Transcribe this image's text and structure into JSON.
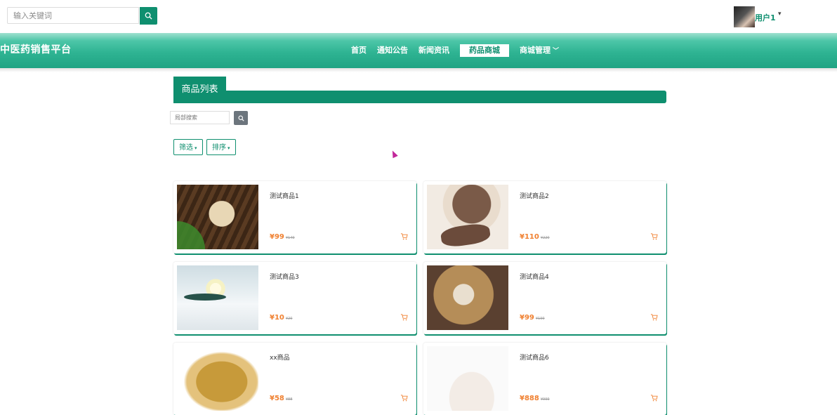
{
  "topbar": {
    "search_placeholder": "输入关键词",
    "username": "用户1"
  },
  "header": {
    "brand": "中医药销售平台",
    "nav": [
      {
        "label": "首页"
      },
      {
        "label": "通知公告"
      },
      {
        "label": "新闻资讯"
      },
      {
        "label": "药品商城",
        "active": true
      },
      {
        "label": "商城管理"
      }
    ]
  },
  "section": {
    "title": "商品列表",
    "local_search_placeholder": "局部搜索",
    "filter_label": "筛选",
    "sort_label": "排序"
  },
  "products": [
    {
      "name": "测试商品1",
      "price": "¥99",
      "old_price": "¥149"
    },
    {
      "name": "测试商品2",
      "price": "¥110",
      "old_price": "¥220"
    },
    {
      "name": "测试商品3",
      "price": "¥10",
      "old_price": "¥20"
    },
    {
      "name": "测试商品4",
      "price": "¥99",
      "old_price": "¥199"
    },
    {
      "name": "xx商品",
      "price": "¥58",
      "old_price": "¥88"
    },
    {
      "name": "测试商品6",
      "price": "¥888",
      "old_price": "¥999"
    }
  ],
  "colors": {
    "accent": "#0f8f6f",
    "price": "#f08030"
  }
}
